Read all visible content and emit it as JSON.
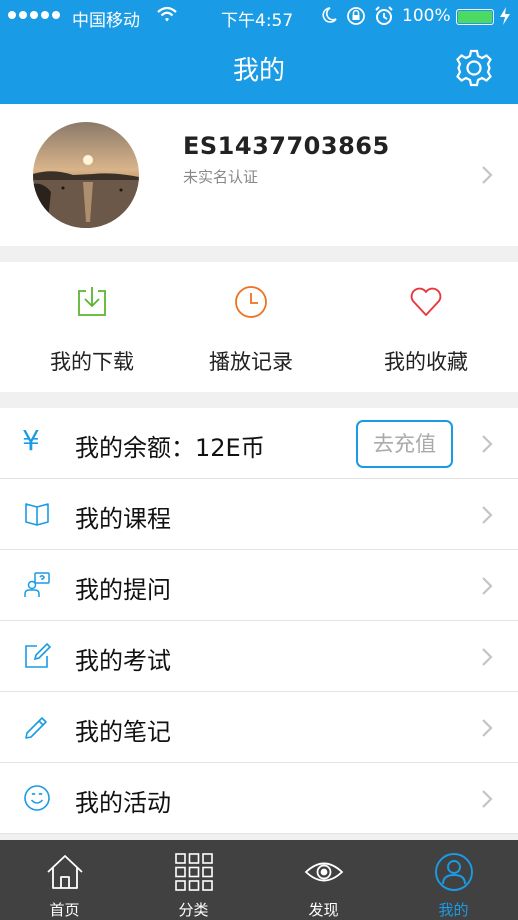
{
  "status_bar": {
    "carrier": "中国移动",
    "time": "下午4:57",
    "battery": "100%"
  },
  "header": {
    "title": "我的"
  },
  "profile": {
    "username": "ES1437703865",
    "verify_status": "未实名认证"
  },
  "quick_actions": [
    {
      "label": "我的下载",
      "icon": "download-icon",
      "color": "#5cb531"
    },
    {
      "label": "播放记录",
      "icon": "clock-icon",
      "color": "#f0701f"
    },
    {
      "label": "我的收藏",
      "icon": "heart-icon",
      "color": "#e8383d"
    }
  ],
  "menu": {
    "balance": {
      "label": "我的余额：12E币",
      "icon": "yen-icon",
      "symbol": "¥",
      "action": "去充值"
    },
    "items": [
      {
        "label": "我的课程",
        "icon": "book-icon"
      },
      {
        "label": "我的提问",
        "icon": "question-icon"
      },
      {
        "label": "我的考试",
        "icon": "exam-icon"
      },
      {
        "label": "我的笔记",
        "icon": "pencil-icon"
      },
      {
        "label": "我的活动",
        "icon": "smile-icon"
      }
    ]
  },
  "tabs": [
    {
      "label": "首页",
      "icon": "home-icon",
      "active": false
    },
    {
      "label": "分类",
      "icon": "grid-icon",
      "active": false
    },
    {
      "label": "发现",
      "icon": "eye-icon",
      "active": false
    },
    {
      "label": "我的",
      "icon": "user-icon",
      "active": true
    }
  ],
  "colors": {
    "accent": "#1a9be6",
    "tabbar": "#414141",
    "background": "#f0f0f0"
  }
}
